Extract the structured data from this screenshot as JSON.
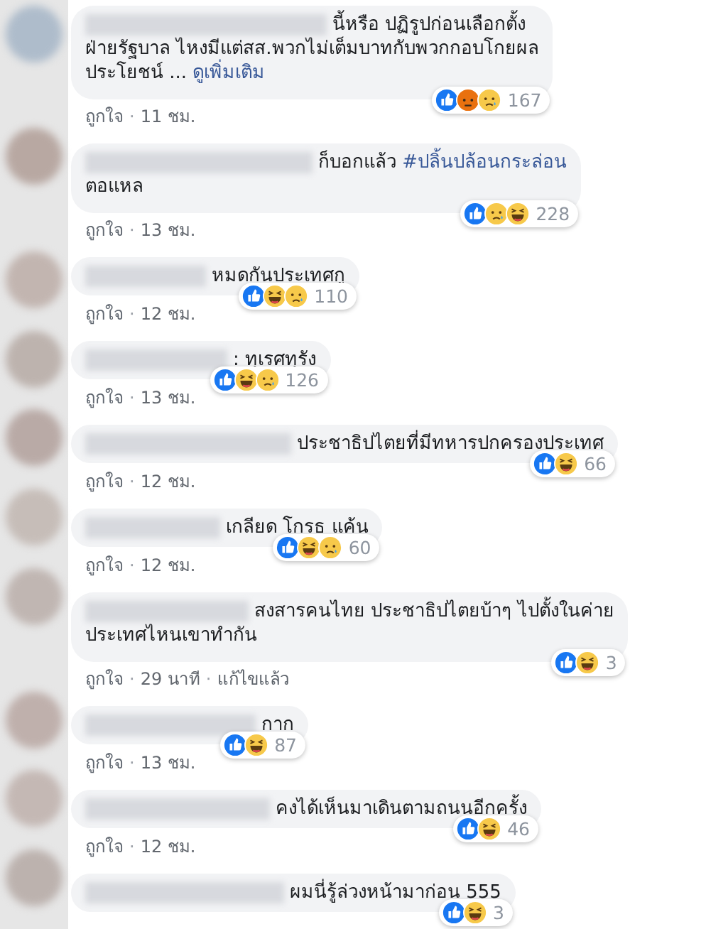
{
  "comments": [
    {
      "lines": [
        [
          {
            "kind": "plain",
            "text": "นี้หรือ ปฏิรูปก่อนเลือกตั้ง"
          }
        ],
        [
          {
            "kind": "plain",
            "text": "ฝ่ายรัฐบาล ไหงมีแต่สส.พวกไม่เต็มบาทกับพวกกอบโกยผล"
          }
        ],
        [
          {
            "kind": "plain",
            "text": "ประโยชน์ ... "
          },
          {
            "kind": "link",
            "text": "ดูเพิ่มเติม"
          }
        ]
      ],
      "reactions": [
        {
          "kind": "like"
        },
        {
          "kind": "angry"
        },
        {
          "kind": "sad"
        }
      ],
      "count": "167",
      "meta": [
        {
          "kind": "link",
          "text": "ถูกใจ"
        },
        {
          "kind": "sep",
          "text": "·"
        },
        {
          "kind": "time",
          "text": "11 ชม."
        }
      ]
    },
    {
      "lines": [
        [
          {
            "kind": "plain",
            "text": "ก็บอกแล้ว "
          },
          {
            "kind": "hashtag",
            "text": "#ปลิ้นปล้อนกระล่อน"
          }
        ],
        [
          {
            "kind": "plain",
            "text": "ตอแหล"
          }
        ]
      ],
      "reactions": [
        {
          "kind": "like"
        },
        {
          "kind": "sad"
        },
        {
          "kind": "haha"
        }
      ],
      "count": "228",
      "meta": [
        {
          "kind": "link",
          "text": "ถูกใจ"
        },
        {
          "kind": "sep",
          "text": "·"
        },
        {
          "kind": "time",
          "text": "13 ชม."
        }
      ]
    },
    {
      "lines": [
        [
          {
            "kind": "plain",
            "text": "หมดกันประเทศกู"
          }
        ]
      ],
      "reactions": [
        {
          "kind": "like"
        },
        {
          "kind": "haha"
        },
        {
          "kind": "sad"
        }
      ],
      "count": "110",
      "meta": [
        {
          "kind": "link",
          "text": "ถูกใจ"
        },
        {
          "kind": "sep",
          "text": "·"
        },
        {
          "kind": "time",
          "text": "12 ชม."
        }
      ]
    },
    {
      "lines": [
        [
          {
            "kind": "plain",
            "text": ": ทุเรศทุรัง"
          }
        ]
      ],
      "reactions": [
        {
          "kind": "like"
        },
        {
          "kind": "haha"
        },
        {
          "kind": "sad"
        }
      ],
      "count": "126",
      "meta": [
        {
          "kind": "link",
          "text": "ถูกใจ"
        },
        {
          "kind": "sep",
          "text": "·"
        },
        {
          "kind": "time",
          "text": "13 ชม."
        }
      ]
    },
    {
      "lines": [
        [
          {
            "kind": "plain",
            "text": "ประชาธิปไตยที่มีทหารปกครองประเทศ"
          }
        ]
      ],
      "reactions": [
        {
          "kind": "like"
        },
        {
          "kind": "haha"
        }
      ],
      "count": "66",
      "meta": [
        {
          "kind": "link",
          "text": "ถูกใจ"
        },
        {
          "kind": "sep",
          "text": "·"
        },
        {
          "kind": "time",
          "text": "12 ชม."
        }
      ]
    },
    {
      "lines": [
        [
          {
            "kind": "plain",
            "text": "เกลียด โกรธ แค้น"
          }
        ]
      ],
      "reactions": [
        {
          "kind": "like"
        },
        {
          "kind": "haha"
        },
        {
          "kind": "sad"
        }
      ],
      "count": "60",
      "meta": [
        {
          "kind": "link",
          "text": "ถูกใจ"
        },
        {
          "kind": "sep",
          "text": "·"
        },
        {
          "kind": "time",
          "text": "12 ชม."
        }
      ]
    },
    {
      "lines": [
        [
          {
            "kind": "plain",
            "text": "สงสารคนไทย ประชาธิปไตยบ้าๆ ไปตั้งในค่าย"
          }
        ],
        [
          {
            "kind": "plain",
            "text": "ประเทศไหนเขาทำกัน"
          }
        ]
      ],
      "reactions": [
        {
          "kind": "like"
        },
        {
          "kind": "haha"
        }
      ],
      "count": "3",
      "meta": [
        {
          "kind": "link",
          "text": "ถูกใจ"
        },
        {
          "kind": "sep",
          "text": "·"
        },
        {
          "kind": "time",
          "text": "29 นาที"
        },
        {
          "kind": "sep",
          "text": "·"
        },
        {
          "kind": "edited",
          "text": "แก้ไขแล้ว"
        }
      ]
    },
    {
      "lines": [
        [
          {
            "kind": "plain",
            "text": "กาก"
          }
        ]
      ],
      "reactions": [
        {
          "kind": "like"
        },
        {
          "kind": "haha"
        }
      ],
      "count": "87",
      "meta": [
        {
          "kind": "link",
          "text": "ถูกใจ"
        },
        {
          "kind": "sep",
          "text": "·"
        },
        {
          "kind": "time",
          "text": "13 ชม."
        }
      ]
    },
    {
      "lines": [
        [
          {
            "kind": "plain",
            "text": "คงได้เห็นมาเดินตามถนนอีกครั้ง"
          }
        ]
      ],
      "reactions": [
        {
          "kind": "like"
        },
        {
          "kind": "haha"
        }
      ],
      "count": "46",
      "meta": [
        {
          "kind": "link",
          "text": "ถูกใจ"
        },
        {
          "kind": "sep",
          "text": "·"
        },
        {
          "kind": "time",
          "text": "12 ชม."
        }
      ]
    },
    {
      "lines": [
        [
          {
            "kind": "plain",
            "text": "ผมนี่รู้ล่วงหน้ามาก่อน 555"
          }
        ]
      ],
      "reactions": [
        {
          "kind": "like"
        },
        {
          "kind": "haha"
        }
      ],
      "count": "3"
    }
  ]
}
